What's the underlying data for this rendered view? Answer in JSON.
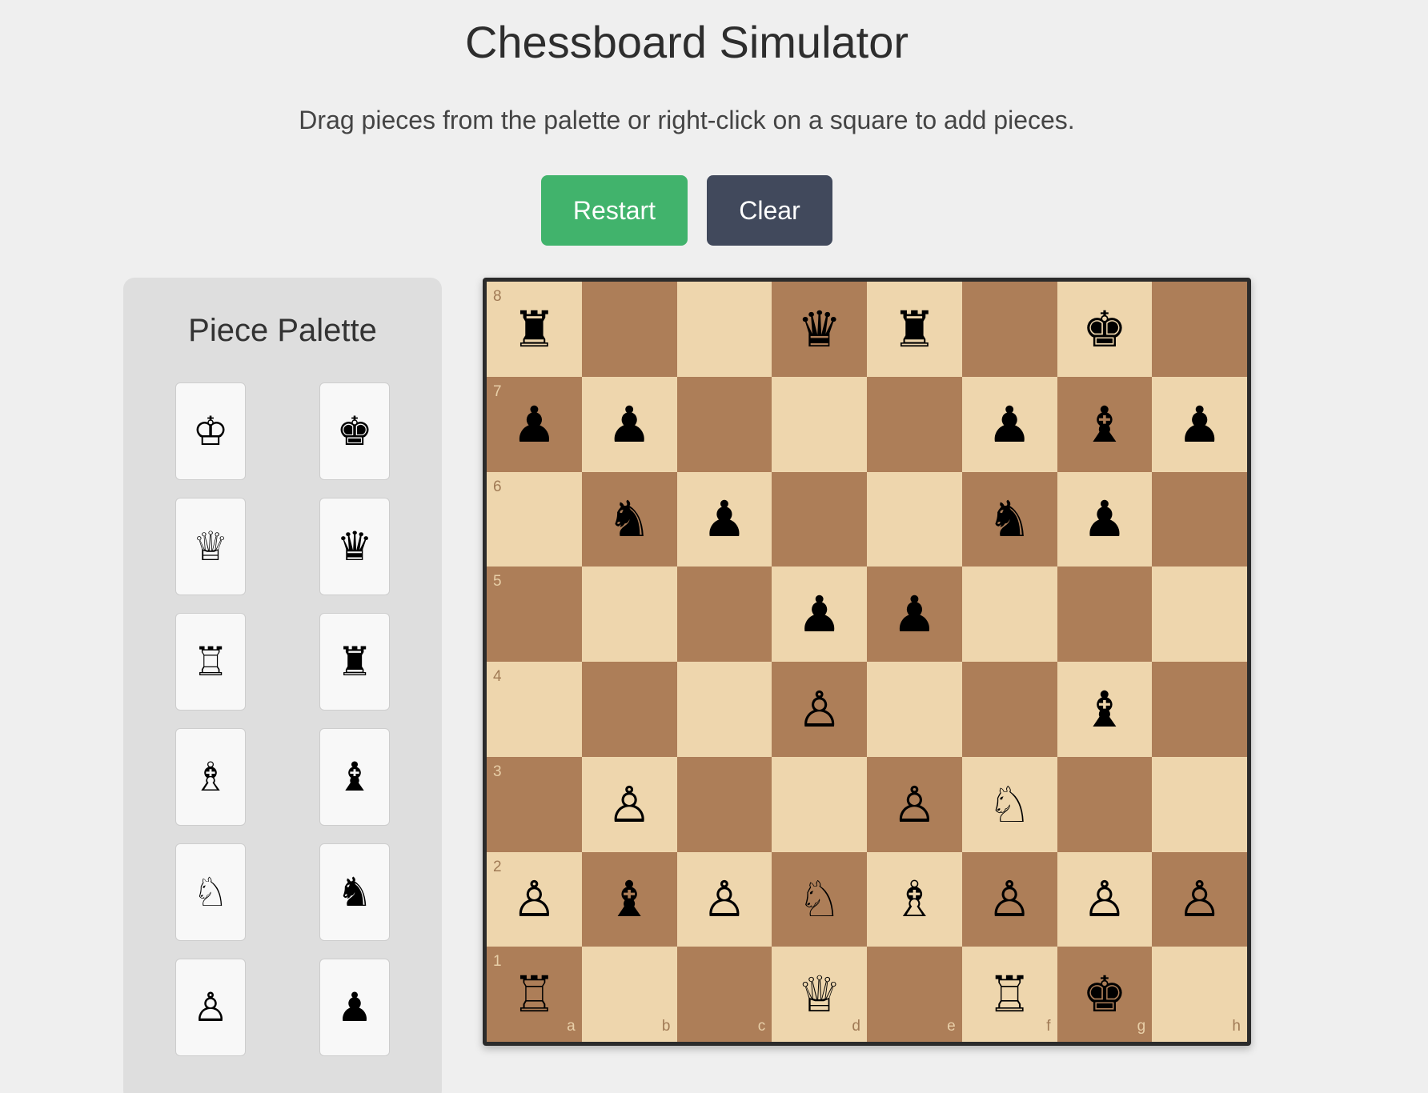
{
  "title": "Chessboard Simulator",
  "subtitle": "Drag pieces from the palette or right-click on a square to add pieces.",
  "buttons": {
    "restart": "Restart",
    "clear": "Clear"
  },
  "palette": {
    "title": "Piece Palette",
    "pieces": [
      {
        "glyph": "♔",
        "name": "white-king"
      },
      {
        "glyph": "♚",
        "name": "black-king"
      },
      {
        "glyph": "♕",
        "name": "white-queen"
      },
      {
        "glyph": "♛",
        "name": "black-queen"
      },
      {
        "glyph": "♖",
        "name": "white-rook"
      },
      {
        "glyph": "♜",
        "name": "black-rook"
      },
      {
        "glyph": "♗",
        "name": "white-bishop"
      },
      {
        "glyph": "♝",
        "name": "black-bishop"
      },
      {
        "glyph": "♘",
        "name": "white-knight"
      },
      {
        "glyph": "♞",
        "name": "black-knight"
      },
      {
        "glyph": "♙",
        "name": "white-pawn"
      },
      {
        "glyph": "♟",
        "name": "black-pawn"
      }
    ]
  },
  "board": {
    "files": [
      "a",
      "b",
      "c",
      "d",
      "e",
      "f",
      "g",
      "h"
    ],
    "ranks": [
      "8",
      "7",
      "6",
      "5",
      "4",
      "3",
      "2",
      "1"
    ],
    "colors": {
      "light": "#eed6ad",
      "dark": "#ad7e58"
    },
    "rows": [
      [
        "♜",
        "",
        "",
        "♛",
        "♜",
        "",
        "♚",
        ""
      ],
      [
        "♟",
        "♟",
        "",
        "",
        "",
        "♟",
        "♝",
        "♟"
      ],
      [
        "",
        "♞",
        "♟",
        "",
        "",
        "♞",
        "♟",
        ""
      ],
      [
        "",
        "",
        "",
        "♟",
        "♟",
        "",
        "",
        ""
      ],
      [
        "",
        "",
        "",
        "♙",
        "",
        "",
        "♝",
        ""
      ],
      [
        "",
        "♙",
        "",
        "",
        "♙",
        "♘",
        "",
        ""
      ],
      [
        "♙",
        "♝",
        "♙",
        "♘",
        "♗",
        "♙",
        "♙",
        "♙"
      ],
      [
        "♖",
        "",
        "",
        "♕",
        "",
        "♖",
        "♚",
        ""
      ]
    ]
  }
}
